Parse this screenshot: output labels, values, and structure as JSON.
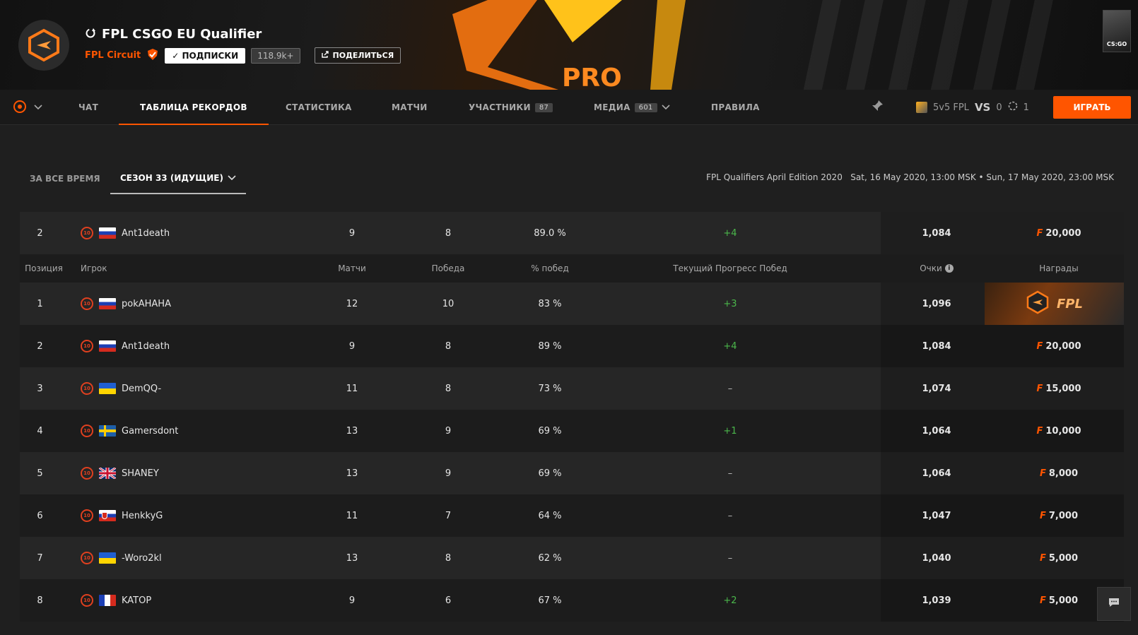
{
  "header": {
    "title": "FPL CSGO EU Qualifier",
    "org_name": "FPL Circuit",
    "subscribe_label": "✓ ПОДПИСКИ",
    "subscribers": "118.9k+",
    "share_label": "ПОДЕЛИТЬСЯ",
    "banner_text": "PRO",
    "game_label": "CS:GO"
  },
  "nav": {
    "tabs": [
      {
        "label": "ЧАТ"
      },
      {
        "label": "ТАБЛИЦА РЕКОРДОВ",
        "active": true
      },
      {
        "label": "СТАТИСТИКА"
      },
      {
        "label": "МАТЧИ"
      },
      {
        "label": "УЧАСТНИКИ",
        "badge": "87"
      },
      {
        "label": "МЕДИА",
        "badge": "601"
      },
      {
        "label": "ПРАВИЛА"
      }
    ],
    "queue_name": "5v5 FPL",
    "vs_label": "VS",
    "vs_count": "0",
    "players_count": "1",
    "play_label": "ИГРАТЬ"
  },
  "filters": {
    "all_time": "ЗА ВСЕ ВРЕМЯ",
    "season": "СЕЗОН 33 (ИДУЩИЕ)"
  },
  "event": {
    "name": "FPL Qualifiers April Edition 2020",
    "dates": "Sat, 16 May 2020, 13:00 MSK • Sun, 17 May 2020, 23:00 MSK"
  },
  "table": {
    "columns": {
      "position": "Позиция",
      "player": "Игрок",
      "matches": "Матчи",
      "wins": "Победа",
      "win_pct": "% побед",
      "streak": "Текущий Прогресс Побед",
      "points": "Очки",
      "prizes": "Награды"
    },
    "pinned": {
      "pos": "2",
      "name": "Ant1death",
      "flag": "ru",
      "matches": "9",
      "wins": "8",
      "pct": "89.0 %",
      "streak": "+4",
      "points": "1,084",
      "prize": "20,000"
    },
    "rows": [
      {
        "pos": "1",
        "name": "pokAHAHA",
        "flag": "ru",
        "matches": "12",
        "wins": "10",
        "pct": "83 %",
        "streak": "+3",
        "points": "1,096",
        "prize": "",
        "ticket": "FPL"
      },
      {
        "pos": "2",
        "name": "Ant1death",
        "flag": "ru",
        "matches": "9",
        "wins": "8",
        "pct": "89 %",
        "streak": "+4",
        "points": "1,084",
        "prize": "20,000"
      },
      {
        "pos": "3",
        "name": "DemQQ-",
        "flag": "ua",
        "matches": "11",
        "wins": "8",
        "pct": "73 %",
        "streak": "–",
        "points": "1,074",
        "prize": "15,000"
      },
      {
        "pos": "4",
        "name": "Gamersdont",
        "flag": "se",
        "matches": "13",
        "wins": "9",
        "pct": "69 %",
        "streak": "+1",
        "points": "1,064",
        "prize": "10,000"
      },
      {
        "pos": "5",
        "name": "SHANEY",
        "flag": "gb",
        "matches": "13",
        "wins": "9",
        "pct": "69 %",
        "streak": "–",
        "points": "1,064",
        "prize": "8,000"
      },
      {
        "pos": "6",
        "name": "HenkkyG",
        "flag": "sk",
        "matches": "11",
        "wins": "7",
        "pct": "64 %",
        "streak": "–",
        "points": "1,047",
        "prize": "7,000"
      },
      {
        "pos": "7",
        "name": "-Woro2kl",
        "flag": "ua",
        "matches": "13",
        "wins": "8",
        "pct": "62 %",
        "streak": "–",
        "points": "1,040",
        "prize": "5,000"
      },
      {
        "pos": "8",
        "name": "KATOP",
        "flag": "fr",
        "matches": "9",
        "wins": "6",
        "pct": "67 %",
        "streak": "+2",
        "points": "1,039",
        "prize": "5,000"
      }
    ],
    "level": "10",
    "currency_symbol": "F"
  },
  "colors": {
    "accent": "#ff5500",
    "positive": "#4bb84b"
  }
}
